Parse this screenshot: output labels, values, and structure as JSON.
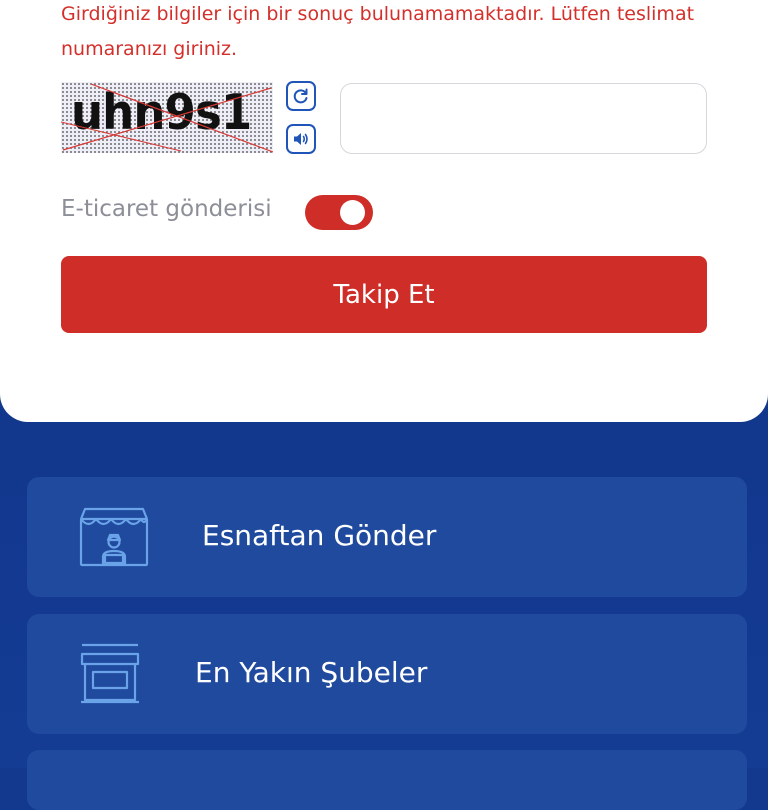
{
  "error_message": "Girdiğiniz bilgiler için bir sonuç bulunamamaktadır. Lütfen teslimat numaranızı giriniz.",
  "captcha": {
    "text": "uhn9s1",
    "input_value": "",
    "refresh_icon": "refresh-icon",
    "audio_icon": "speaker-icon"
  },
  "ecommerce": {
    "label": "E-ticaret gönderisi",
    "toggle_on": true
  },
  "track_button_label": "Takip Et",
  "menu": [
    {
      "label": "Esnaftan Gönder",
      "icon": "merchant-shop-icon"
    },
    {
      "label": "En Yakın Şubeler",
      "icon": "storefront-icon"
    }
  ],
  "colors": {
    "accent_red": "#cf2e28",
    "error_red": "#d4302b",
    "background_blue": "#13398f",
    "card_blue": "#1f4a9e",
    "icon_blue": "#6aa3e8"
  }
}
